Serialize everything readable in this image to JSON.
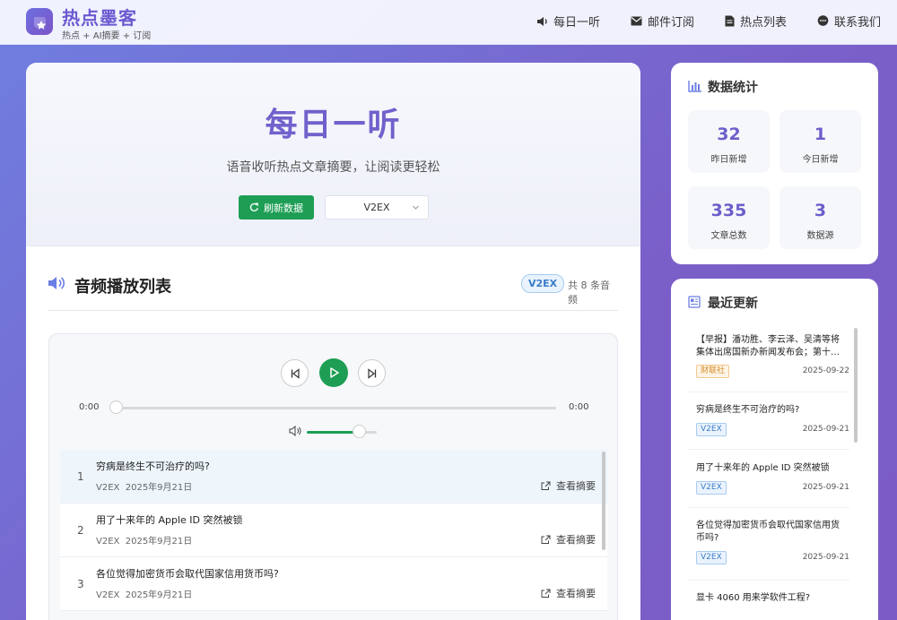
{
  "brand": {
    "title": "热点墨客",
    "subtitle": "热点 + AI摘要 + 订阅"
  },
  "nav": [
    {
      "label": "每日一听",
      "icon": "speaker-icon"
    },
    {
      "label": "邮件订阅",
      "icon": "envelope-icon"
    },
    {
      "label": "热点列表",
      "icon": "document-icon"
    },
    {
      "label": "联系我们",
      "icon": "chat-icon"
    }
  ],
  "hero": {
    "title": "每日一听",
    "subtitle": "语音收听热点文章摘要，让阅读更轻松",
    "refresh_label": "刷新数据",
    "source_selected": "V2EX"
  },
  "playlist": {
    "title": "音频播放列表",
    "badge": "V2EX",
    "count_text": "共 8 条音频",
    "time_current": "0:00",
    "time_total": "0:00",
    "volume_level": 0.74,
    "link_label": "查看摘要",
    "tracks": [
      {
        "num": "1",
        "title": "穷病是终生不可治疗的吗?",
        "source": "V2EX",
        "date": "2025年9月21日"
      },
      {
        "num": "2",
        "title": "用了十来年的 Apple ID 突然被锁",
        "source": "V2EX",
        "date": "2025年9月21日"
      },
      {
        "num": "3",
        "title": "各位觉得加密货币会取代国家信用货币吗?",
        "source": "V2EX",
        "date": "2025年9月21日"
      }
    ]
  },
  "stats": {
    "title": "数据统计",
    "items": [
      {
        "value": "32",
        "label": "昨日新增"
      },
      {
        "value": "1",
        "label": "今日新增"
      },
      {
        "value": "335",
        "label": "文章总数"
      },
      {
        "value": "3",
        "label": "数据源"
      }
    ]
  },
  "recent": {
    "title": "最近更新",
    "items": [
      {
        "title": "【早报】潘功胜、李云泽、吴清等将集体出席国新办新闻发布会；第十…",
        "tag": "财联社",
        "date": "2025-09-22"
      },
      {
        "title": "穷病是终生不可治疗的吗?",
        "tag": "V2EX",
        "date": "2025-09-21"
      },
      {
        "title": "用了十来年的 Apple ID 突然被锁",
        "tag": "V2EX",
        "date": "2025-09-21"
      },
      {
        "title": "各位觉得加密货币会取代国家信用货币吗?",
        "tag": "V2EX",
        "date": "2025-09-21"
      },
      {
        "title": "显卡 4060 用来学软件工程?",
        "tag": "",
        "date": ""
      }
    ]
  },
  "colors": {
    "accent": "#7062cc",
    "primary_green": "#1e9e55"
  }
}
